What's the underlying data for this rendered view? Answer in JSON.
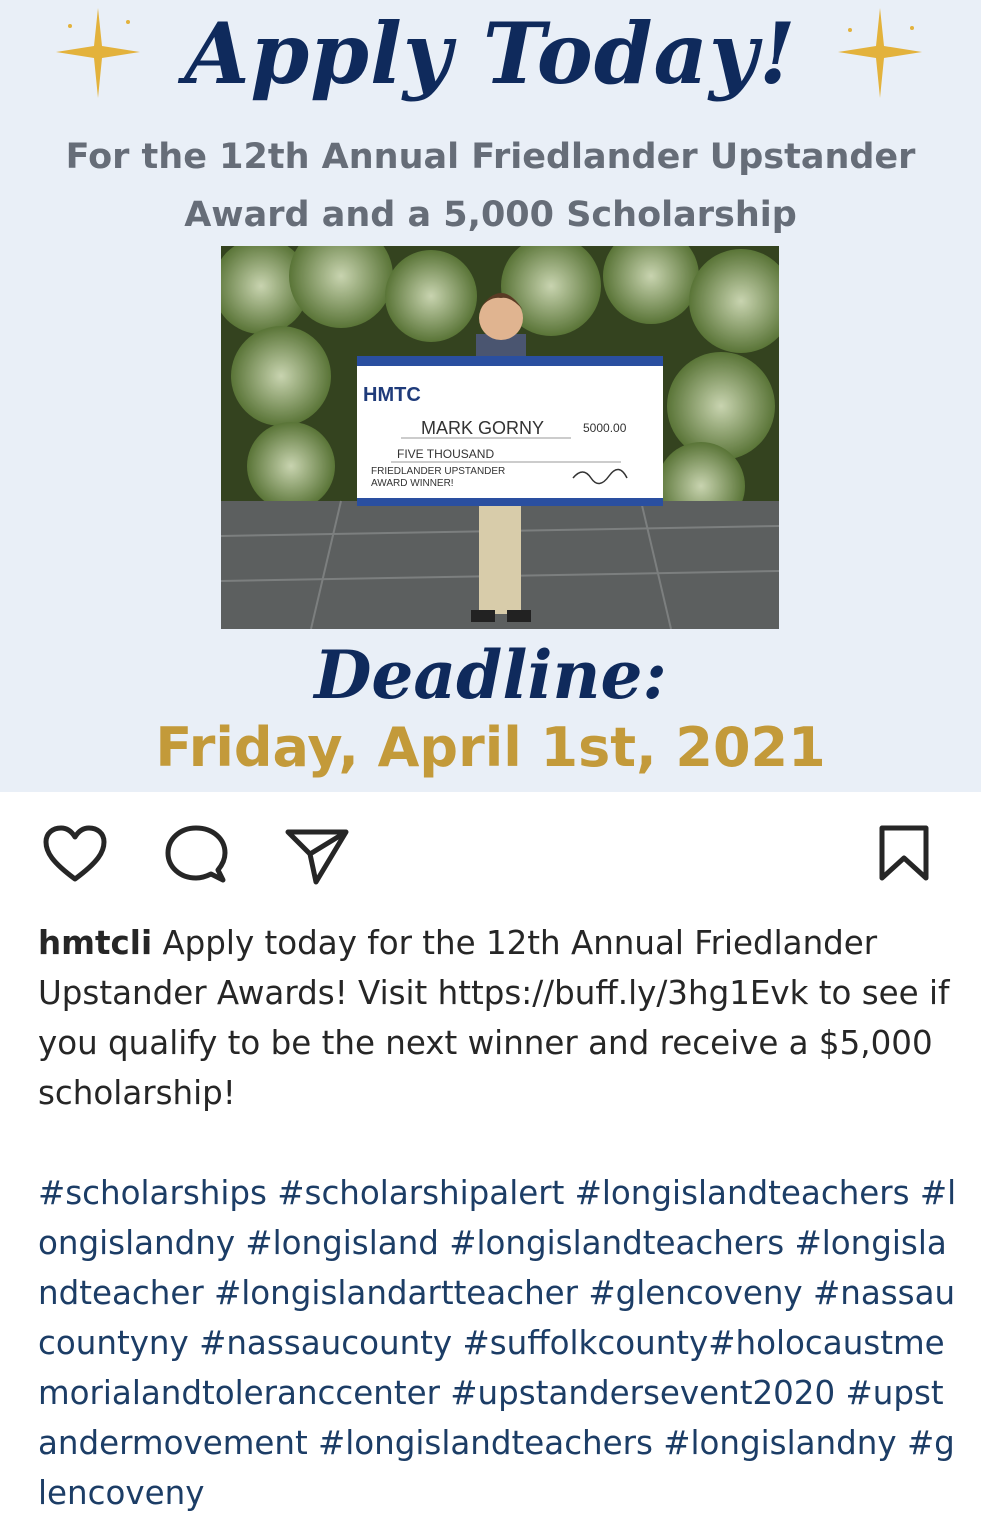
{
  "post": {
    "headline": "Apply Today!",
    "subhead_line1": "For the 12th Annual Friedlander Upstander",
    "subhead_line2": "Award and a 5,000 Scholarship",
    "check": {
      "logo": "HMTC",
      "payee": "MARK GORNY",
      "amount": "5000.00",
      "amount_words": "FIVE THOUSAND",
      "memo1": "FRIEDLANDER UPSTANDER",
      "memo2": "AWARD WINNER!"
    },
    "deadline_label": "Deadline:",
    "deadline_date": "Friday, April 1st, 2021",
    "colors": {
      "navy": "#0f2a5c",
      "gold": "#c39a3a",
      "gray": "#666d78",
      "background": "#e9eff7"
    }
  },
  "actions": {
    "like": "heart-icon",
    "comment": "comment-icon",
    "share": "send-icon",
    "save": "bookmark-icon"
  },
  "caption": {
    "username": "hmtcli",
    "text": "Apply today for the 12th Annual Friedlander Upstander Awards! Visit https://buff.ly/3hg1Evk to see if you qualify to be the next winner and receive a $5,000 scholarship!",
    "hashtags": "#scholarships #scholarshipalert #longislandteachers #longislandny #longisland #longislandteachers #longislandteacher #longislandartteacher #glencoveny #nassaucountyny #nassaucounty #suffolkcounty#holocaustmemorialandtoleranccenter #upstandersevent2020 #upstandermovement #longislandteachers #longislandny #glencoveny"
  }
}
